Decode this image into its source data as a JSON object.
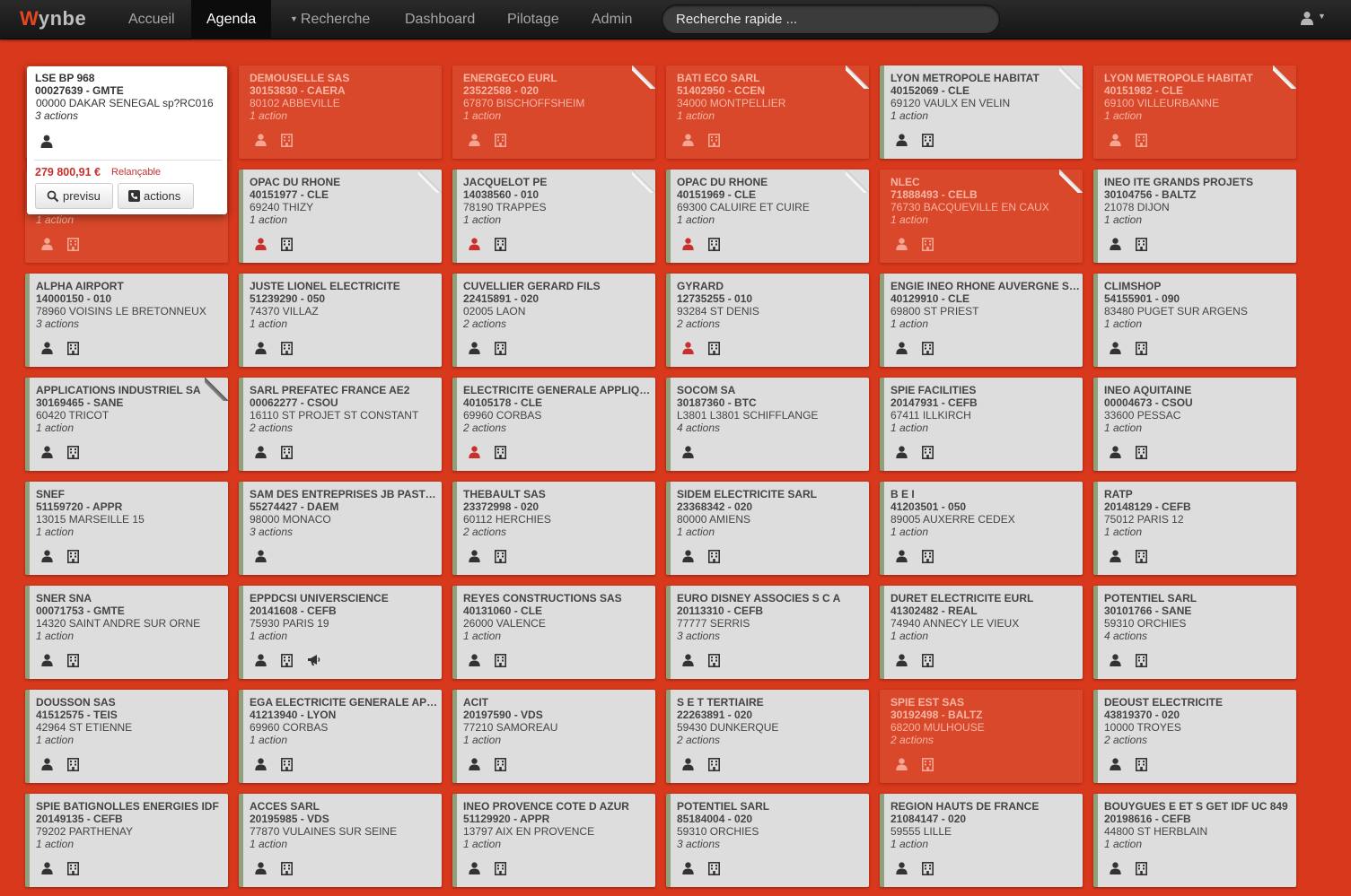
{
  "app": {
    "brand_w": "W",
    "brand_rest": "ynbe",
    "colors": {
      "background": "#d8381c",
      "brand": "#e8461f",
      "card": "#dddddd",
      "alert_card": "#d9482a",
      "amount": "#c9302c"
    }
  },
  "nav": {
    "items": [
      {
        "label": "Accueil",
        "active": false
      },
      {
        "label": "Agenda",
        "active": true
      },
      {
        "label": "Recherche",
        "active": false,
        "dropdown": true
      },
      {
        "label": "Dashboard",
        "active": false
      },
      {
        "label": "Pilotage",
        "active": false
      },
      {
        "label": "Admin",
        "active": false
      }
    ],
    "search_placeholder": "Recherche rapide ...",
    "user_icon": "user-icon"
  },
  "popover": {
    "name": "LSE BP 968",
    "code": "00027639 - GMTE",
    "city": "00000 DAKAR SENEGAL sp?RC016",
    "actions": "3 actions",
    "amount": "279 800,91 €",
    "status": "Relançable",
    "previsu_label": "previsu",
    "actions_label": "actions"
  },
  "cards": [
    {
      "name": "",
      "code": "",
      "city": "",
      "actions": "1 action",
      "alert": true,
      "fold": false,
      "icons": [
        "user",
        "building"
      ]
    },
    {
      "name": "DEMOUSELLE SAS",
      "code": "30153830 - CAERA",
      "city": "80102 ABBEVILLE",
      "actions": "1 action",
      "alert": true,
      "fold": false,
      "icons": [
        "user",
        "building"
      ]
    },
    {
      "name": "ENERGECO EURL",
      "code": "23522588 - 020",
      "city": "67870 BISCHOFFSHEIM",
      "actions": "1 action",
      "alert": true,
      "fold": true,
      "icons": [
        "user",
        "building"
      ]
    },
    {
      "name": "BATI ECO SARL",
      "code": "51402950 - CCEN",
      "city": "34000 MONTPELLIER",
      "actions": "1 action",
      "alert": true,
      "fold": true,
      "icons": [
        "user",
        "building"
      ]
    },
    {
      "name": "LYON METROPOLE HABITAT",
      "code": "40152069 - CLE",
      "city": "69120 VAULX EN VELIN",
      "actions": "1 action",
      "alert": false,
      "fold": true,
      "icons": [
        "user",
        "building"
      ]
    },
    {
      "name": "LYON METROPOLE HABITAT",
      "code": "40151982 - CLE",
      "city": "69100 VILLEURBANNE",
      "actions": "1 action",
      "alert": true,
      "fold": true,
      "icons": [
        "user",
        "building"
      ]
    },
    {
      "name": "",
      "code": "",
      "city": "",
      "actions": "1 action",
      "alert": true,
      "fold": false,
      "icons": [
        "user",
        "building"
      ]
    },
    {
      "name": "OPAC DU RHONE",
      "code": "40151977 - CLE",
      "city": "69240 THIZY",
      "actions": "1 action",
      "alert": false,
      "fold": true,
      "icons": [
        "user-red",
        "building"
      ]
    },
    {
      "name": "JACQUELOT PE",
      "code": "14038560 - 010",
      "city": "78190 TRAPPES",
      "actions": "1 action",
      "alert": false,
      "fold": true,
      "icons": [
        "user-red",
        "building"
      ]
    },
    {
      "name": "OPAC DU RHONE",
      "code": "40151969 - CLE",
      "city": "69300 CALUIRE ET CUIRE",
      "actions": "1 action",
      "alert": false,
      "fold": true,
      "icons": [
        "user-red",
        "building"
      ]
    },
    {
      "name": "NLEC",
      "code": "71888493 - CELB",
      "city": "76730 BACQUEVILLE EN CAUX",
      "actions": "1 action",
      "alert": true,
      "fold": true,
      "icons": [
        "user",
        "building"
      ]
    },
    {
      "name": "INEO ITE GRANDS PROJETS",
      "code": "30104756 - BALTZ",
      "city": "21078 DIJON",
      "actions": "1 action",
      "alert": false,
      "fold": false,
      "icons": [
        "user",
        "building"
      ]
    },
    {
      "name": "ALPHA AIRPORT",
      "code": "14000150 - 010",
      "city": "78960 VOISINS LE BRETONNEUX",
      "actions": "3 actions",
      "alert": false,
      "fold": false,
      "icons": [
        "user",
        "building"
      ]
    },
    {
      "name": "JUSTE LIONEL ELECTRICITE",
      "code": "51239290 - 050",
      "city": "74370 VILLAZ",
      "actions": "1 action",
      "alert": false,
      "fold": false,
      "icons": [
        "user",
        "building"
      ]
    },
    {
      "name": "CUVELLIER GERARD FILS",
      "code": "22415891 - 020",
      "city": "02005 LAON",
      "actions": "2 actions",
      "alert": false,
      "fold": false,
      "icons": [
        "user",
        "building"
      ]
    },
    {
      "name": "GYRARD",
      "code": "12735255 - 010",
      "city": "93284 ST DENIS",
      "actions": "2 actions",
      "alert": false,
      "fold": false,
      "icons": [
        "user-red",
        "building"
      ]
    },
    {
      "name": "ENGIE INEO RHONE AUVERGNE SN...",
      "code": "40129910 - CLE",
      "city": "69800 ST PRIEST",
      "actions": "1 action",
      "alert": false,
      "fold": false,
      "icons": [
        "user",
        "building"
      ]
    },
    {
      "name": "CLIMSHOP",
      "code": "54155901 - 090",
      "city": "83480 PUGET SUR ARGENS",
      "actions": "1 action",
      "alert": false,
      "fold": false,
      "icons": [
        "user",
        "building"
      ]
    },
    {
      "name": "APPLICATIONS INDUSTRIEL SA",
      "code": "30169465 - SANE",
      "city": "60420 TRICOT",
      "actions": "1 action",
      "alert": false,
      "fold": "dark",
      "icons": [
        "user",
        "building"
      ]
    },
    {
      "name": "SARL PREFATEC FRANCE AE2",
      "code": "00062277 - CSOU",
      "city": "16110 ST PROJET ST CONSTANT",
      "actions": "2 actions",
      "alert": false,
      "fold": false,
      "icons": [
        "user",
        "building"
      ]
    },
    {
      "name": "ELECTRICITE GENERALE APPLIQU...",
      "code": "40105178 - CLE",
      "city": "69960 CORBAS",
      "actions": "2 actions",
      "alert": false,
      "fold": false,
      "icons": [
        "user-red",
        "building"
      ]
    },
    {
      "name": "SOCOM SA",
      "code": "30187360 - BTC",
      "city": "L3801 L3801 SCHIFFLANGE",
      "actions": "4 actions",
      "alert": false,
      "fold": false,
      "icons": [
        "user"
      ]
    },
    {
      "name": "SPIE FACILITIES",
      "code": "20147931 - CEFB",
      "city": "67411 ILLKIRCH",
      "actions": "1 action",
      "alert": false,
      "fold": false,
      "icons": [
        "user",
        "building"
      ]
    },
    {
      "name": "INEO AQUITAINE",
      "code": "00004673 - CSOU",
      "city": "33600 PESSAC",
      "actions": "1 action",
      "alert": false,
      "fold": false,
      "icons": [
        "user",
        "building"
      ]
    },
    {
      "name": "SNEF",
      "code": "51159720 - APPR",
      "city": "13015 MARSEILLE 15",
      "actions": "1 action",
      "alert": false,
      "fold": false,
      "icons": [
        "user",
        "building"
      ]
    },
    {
      "name": "SAM DES ENTREPRISES JB PASTOR",
      "code": "55274427 - DAEM",
      "city": "98000 MONACO",
      "actions": "3 actions",
      "alert": false,
      "fold": false,
      "icons": [
        "user"
      ]
    },
    {
      "name": "THEBAULT SAS",
      "code": "23372998 - 020",
      "city": "60112 HERCHIES",
      "actions": "2 actions",
      "alert": false,
      "fold": false,
      "icons": [
        "user",
        "building"
      ]
    },
    {
      "name": "SIDEM ELECTRICITE SARL",
      "code": "23368342 - 020",
      "city": "80000 AMIENS",
      "actions": "1 action",
      "alert": false,
      "fold": false,
      "icons": [
        "user",
        "building"
      ]
    },
    {
      "name": "B E I",
      "code": "41203501 - 050",
      "city": "89005 AUXERRE CEDEX",
      "actions": "1 action",
      "alert": false,
      "fold": false,
      "icons": [
        "user",
        "building"
      ]
    },
    {
      "name": "RATP",
      "code": "20148129 - CEFB",
      "city": "75012 PARIS 12",
      "actions": "1 action",
      "alert": false,
      "fold": false,
      "icons": [
        "user",
        "building"
      ]
    },
    {
      "name": "SNER SNA",
      "code": "00071753 - GMTE",
      "city": "14320 SAINT ANDRE SUR ORNE",
      "actions": "1 action",
      "alert": false,
      "fold": false,
      "icons": [
        "user",
        "building"
      ]
    },
    {
      "name": "EPPDCSI UNIVERSCIENCE",
      "code": "20141608 - CEFB",
      "city": "75930 PARIS 19",
      "actions": "1 action",
      "alert": false,
      "fold": false,
      "icons": [
        "user",
        "building",
        "bullhorn"
      ]
    },
    {
      "name": "REYES CONSTRUCTIONS SAS",
      "code": "40131060 - CLE",
      "city": "26000 VALENCE",
      "actions": "1 action",
      "alert": false,
      "fold": false,
      "icons": [
        "user",
        "building"
      ]
    },
    {
      "name": "EURO DISNEY ASSOCIES S C A",
      "code": "20113310 - CEFB",
      "city": "77777 SERRIS",
      "actions": "3 actions",
      "alert": false,
      "fold": false,
      "icons": [
        "user",
        "building"
      ]
    },
    {
      "name": "DURET ELECTRICITE EURL",
      "code": "41302482 - REAL",
      "city": "74940 ANNECY LE VIEUX",
      "actions": "1 action",
      "alert": false,
      "fold": false,
      "icons": [
        "user",
        "building"
      ]
    },
    {
      "name": "POTENTIEL SARL",
      "code": "30101766 - SANE",
      "city": "59310 ORCHIES",
      "actions": "4 actions",
      "alert": false,
      "fold": false,
      "icons": [
        "user",
        "building"
      ]
    },
    {
      "name": "DOUSSON SAS",
      "code": "41512575 - TEIS",
      "city": "42964 ST ETIENNE",
      "actions": "1 action",
      "alert": false,
      "fold": false,
      "icons": [
        "user",
        "building"
      ]
    },
    {
      "name": "EGA ELECTRICITE GENERALE APP...",
      "code": "41213940 - LYON",
      "city": "69960 CORBAS",
      "actions": "1 action",
      "alert": false,
      "fold": false,
      "icons": [
        "user",
        "building"
      ]
    },
    {
      "name": "ACIT",
      "code": "20197590 - VDS",
      "city": "77210 SAMOREAU",
      "actions": "1 action",
      "alert": false,
      "fold": false,
      "icons": [
        "user",
        "building"
      ]
    },
    {
      "name": "S E T TERTIAIRE",
      "code": "22263891 - 020",
      "city": "59430 DUNKERQUE",
      "actions": "2 actions",
      "alert": false,
      "fold": false,
      "icons": [
        "user",
        "building"
      ]
    },
    {
      "name": "SPIE EST SAS",
      "code": "30192498 - BALTZ",
      "city": "68200 MULHOUSE",
      "actions": "2 actions",
      "alert": true,
      "fold": false,
      "icons": [
        "user",
        "building"
      ]
    },
    {
      "name": "DEOUST ELECTRICITE",
      "code": "43819370 - 020",
      "city": "10000 TROYES",
      "actions": "2 actions",
      "alert": false,
      "fold": false,
      "icons": [
        "user",
        "building"
      ]
    },
    {
      "name": "SPIE BATIGNOLLES ENERGIES IDF",
      "code": "20149135 - CEFB",
      "city": "79202 PARTHENAY",
      "actions": "1 action",
      "alert": false,
      "fold": false,
      "icons": [
        "user",
        "building"
      ]
    },
    {
      "name": "ACCES SARL",
      "code": "20195985 - VDS",
      "city": "77870 VULAINES SUR SEINE",
      "actions": "1 action",
      "alert": false,
      "fold": false,
      "icons": [
        "user",
        "building"
      ]
    },
    {
      "name": "INEO PROVENCE COTE D AZUR",
      "code": "51129920 - APPR",
      "city": "13797 AIX EN PROVENCE",
      "actions": "1 action",
      "alert": false,
      "fold": false,
      "icons": [
        "user",
        "building"
      ]
    },
    {
      "name": "POTENTIEL SARL",
      "code": "85184004 - 020",
      "city": "59310 ORCHIES",
      "actions": "3 actions",
      "alert": false,
      "fold": false,
      "icons": [
        "user",
        "building"
      ]
    },
    {
      "name": "REGION HAUTS DE FRANCE",
      "code": "21084147 - 020",
      "city": "59555 LILLE",
      "actions": "1 action",
      "alert": false,
      "fold": false,
      "icons": [
        "user",
        "building"
      ]
    },
    {
      "name": "BOUYGUES E ET S GET IDF UC 849",
      "code": "20198616 - CEFB",
      "city": "44800 ST HERBLAIN",
      "actions": "1 action",
      "alert": false,
      "fold": false,
      "icons": [
        "user",
        "building"
      ]
    }
  ]
}
